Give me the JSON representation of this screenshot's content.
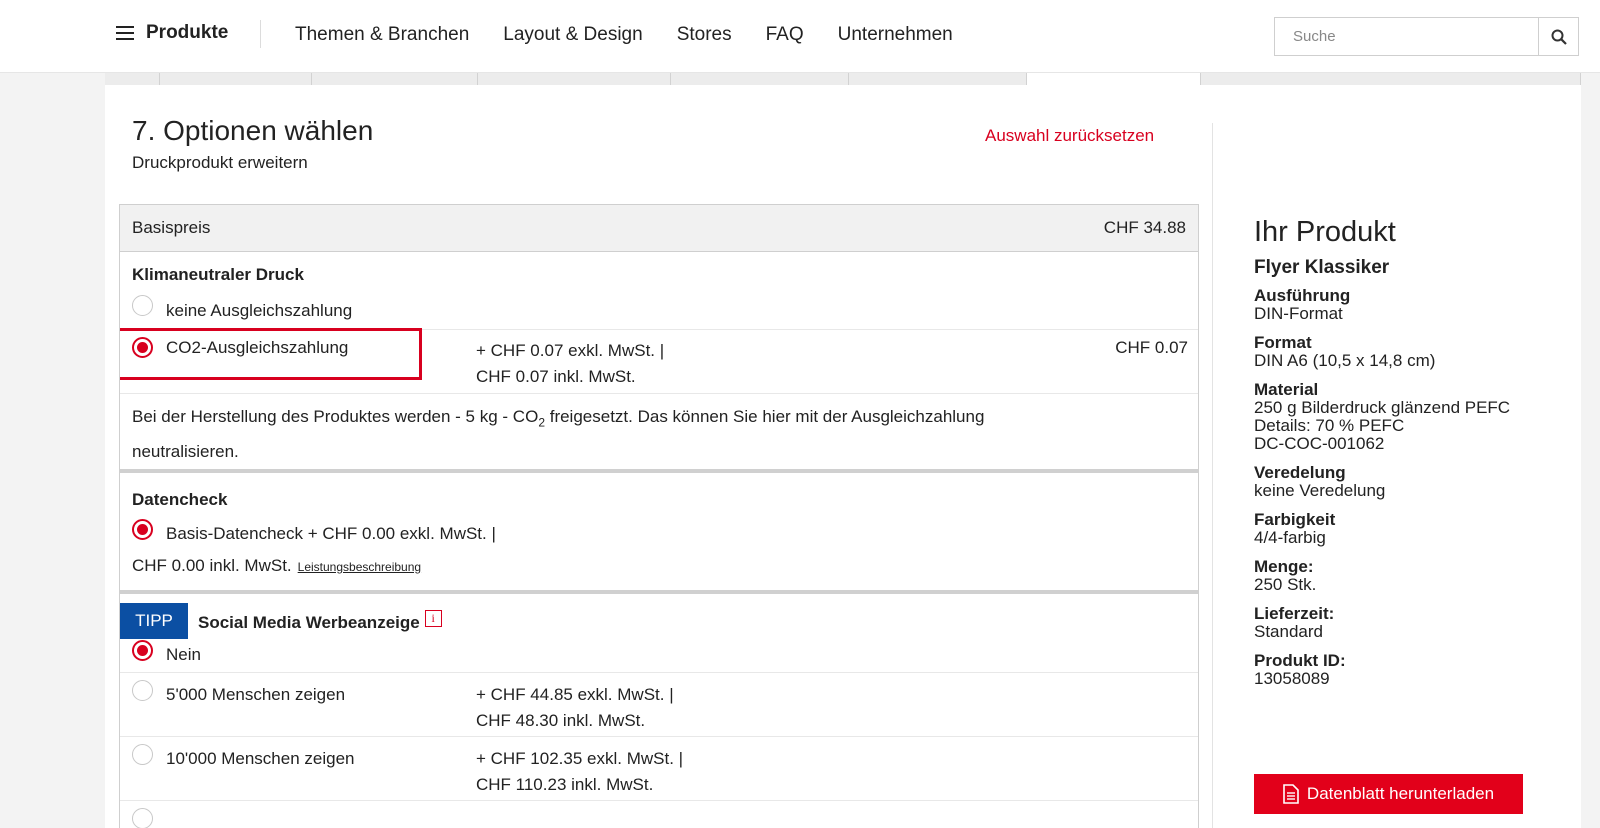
{
  "header": {
    "menu_label": "Produkte",
    "nav": [
      "Themen & Branchen",
      "Layout & Design",
      "Stores",
      "FAQ",
      "Unternehmen"
    ],
    "search_placeholder": "Suche"
  },
  "section": {
    "title": "7. Optionen wählen",
    "subtitle": "Druckprodukt erweitern",
    "reset_label": "Auswahl zurücksetzen"
  },
  "base": {
    "label": "Basispreis",
    "price": "CHF 34.88"
  },
  "climate": {
    "title": "Klimaneutraler Druck",
    "options": [
      {
        "label": "keine Ausgleichszahlung",
        "selected": false
      },
      {
        "label": "CO2-Ausgleichszahlung",
        "selected": true,
        "price_excl": "+ CHF 0.07 exkl. MwSt. |",
        "price_incl": "CHF 0.07 inkl. MwSt.",
        "total": "CHF 0.07"
      }
    ],
    "desc_part1": "Bei der Herstellung des Produktes werden - 5 kg - CO",
    "desc_sub": "2",
    "desc_part2": " freigesetzt. Das können Sie hier mit der Ausgleichzahlung",
    "desc_line2": "neutralisieren."
  },
  "datacheck": {
    "title": "Datencheck",
    "option_label": "Basis-Datencheck + CHF 0.00 exkl. MwSt. |",
    "option_line2": "CHF 0.00 inkl. MwSt.",
    "link": "Leistungsbeschreibung"
  },
  "social": {
    "badge": "TIPP",
    "title": "Social Media Werbeanzeige",
    "info": "i",
    "options": [
      {
        "label": "Nein",
        "selected": true
      },
      {
        "label": "5'000 Menschen zeigen",
        "selected": false,
        "price_excl": "+ CHF 44.85 exkl. MwSt. |",
        "price_incl": "CHF 48.30 inkl. MwSt."
      },
      {
        "label": "10'000 Menschen zeigen",
        "selected": false,
        "price_excl": "+ CHF 102.35 exkl. MwSt. |",
        "price_incl": "CHF 110.23 inkl. MwSt."
      }
    ]
  },
  "sidebar": {
    "heading": "Ihr Produkt",
    "product": "Flyer Klassiker",
    "items": [
      {
        "k": "Ausführung",
        "v": "DIN-Format"
      },
      {
        "k": "Format",
        "v": "DIN A6 (10,5 x 14,8 cm)"
      },
      {
        "k": "Material",
        "v": "250 g Bilderdruck glänzend PEFC",
        "v2": "Details: 70 % PEFC",
        "v3": "DC-COC-001062"
      },
      {
        "k": "Veredelung",
        "v": "keine Veredelung"
      },
      {
        "k": "Farbigkeit",
        "v": "4/4-farbig"
      },
      {
        "k": "Menge:",
        "v": "250 Stk."
      },
      {
        "k": "Lieferzeit:",
        "v": "Standard"
      },
      {
        "k": "Produkt ID:",
        "v": "13058089"
      }
    ],
    "download_label": "Datenblatt herunterladen"
  },
  "colors": {
    "accent": "#d8001f",
    "tipp": "#0b4fa3"
  }
}
